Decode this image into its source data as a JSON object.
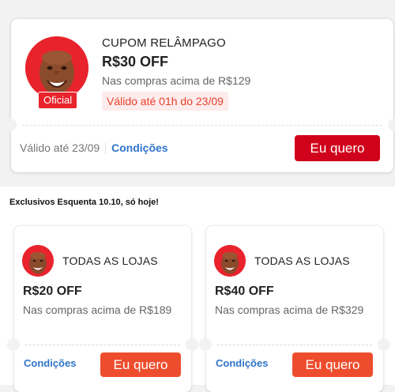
{
  "main_coupon": {
    "badge": "Oficial",
    "kicker": "CUPOM RELÂMPAGO",
    "amount": "R$30 OFF",
    "condition": "Nas compras acima de R$129",
    "validity_tag": "Válido até 01h do 23/09",
    "footer_valid": "Válido até 23/09",
    "conditions_link": "Condições",
    "cta": "Eu quero"
  },
  "section": {
    "title": "Exclusivos Esquenta 10.10, só hoje!"
  },
  "small_coupons": [
    {
      "kicker": "TODAS AS LOJAS",
      "amount": "R$20 OFF",
      "condition": "Nas compras acima de R$189",
      "conditions_link": "Condições",
      "cta": "Eu quero"
    },
    {
      "kicker": "TODAS AS LOJAS",
      "amount": "R$40 OFF",
      "condition": "Nas compras acima de R$329",
      "conditions_link": "Condições",
      "cta": "Eu quero"
    }
  ],
  "colors": {
    "brand_red": "#d0011b",
    "accent_orange": "#ee4d2d",
    "link_blue": "#2f74c8"
  },
  "icons": {
    "avatar": "mascot-face-avatar"
  }
}
